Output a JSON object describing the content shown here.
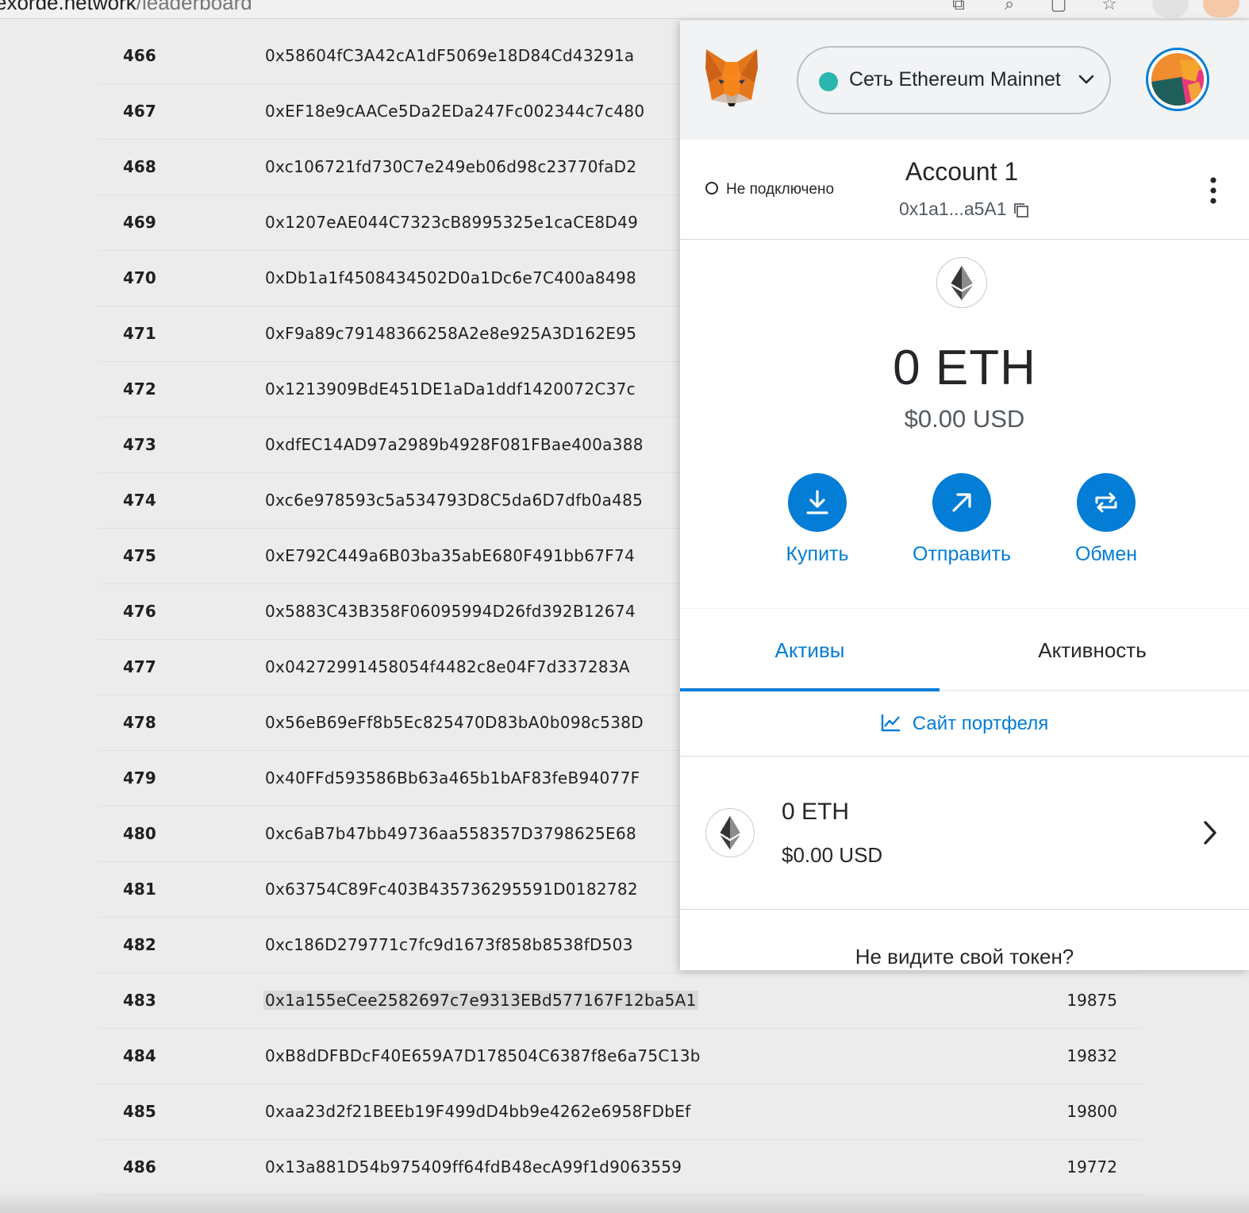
{
  "browser": {
    "url_host": "exorde.network",
    "url_path": "/leaderboard"
  },
  "leaderboard": {
    "rows": [
      {
        "rank": "466",
        "address": "0x58604fC3A42cA1dF5069e18D84Cd43291a",
        "score": ""
      },
      {
        "rank": "467",
        "address": "0xEF18e9cAACe5Da2EDa247Fc002344c7c480",
        "score": ""
      },
      {
        "rank": "468",
        "address": "0xc106721fd730C7e249eb06d98c23770faD2",
        "score": ""
      },
      {
        "rank": "469",
        "address": "0x1207eAE044C7323cB8995325e1caCE8D49",
        "score": ""
      },
      {
        "rank": "470",
        "address": "0xDb1a1f4508434502D0a1Dc6e7C400a8498",
        "score": ""
      },
      {
        "rank": "471",
        "address": "0xF9a89c79148366258A2e8e925A3D162E95",
        "score": ""
      },
      {
        "rank": "472",
        "address": "0x1213909BdE451DE1aDa1ddf1420072C37c",
        "score": ""
      },
      {
        "rank": "473",
        "address": "0xdfEC14AD97a2989b4928F081FBae400a388",
        "score": ""
      },
      {
        "rank": "474",
        "address": "0xc6e978593c5a534793D8C5da6D7dfb0a485",
        "score": ""
      },
      {
        "rank": "475",
        "address": "0xE792C449a6B03ba35abE680F491bb67F74",
        "score": ""
      },
      {
        "rank": "476",
        "address": "0x5883C43B358F06095994D26fd392B12674",
        "score": ""
      },
      {
        "rank": "477",
        "address": "0x04272991458054f4482c8e04F7d337283A",
        "score": ""
      },
      {
        "rank": "478",
        "address": "0x56eB69eFf8b5Ec825470D83bA0b098c538D",
        "score": ""
      },
      {
        "rank": "479",
        "address": "0x40FFd593586Bb63a465b1bAF83feB94077F",
        "score": ""
      },
      {
        "rank": "480",
        "address": "0xc6aB7b47bb49736aa558357D3798625E68",
        "score": ""
      },
      {
        "rank": "481",
        "address": "0x63754C89Fc403B435736295591D0182782",
        "score": ""
      },
      {
        "rank": "482",
        "address": "0xc186D279771c7fc9d1673f858b8538fD503",
        "score": ""
      },
      {
        "rank": "483",
        "address": "0x1a155eCee2582697c7e9313EBd577167F12ba5A1",
        "score": "19875",
        "highlighted": true
      },
      {
        "rank": "484",
        "address": "0xB8dDFBDcF40E659A7D178504C6387f8e6a75C13b",
        "score": "19832"
      },
      {
        "rank": "485",
        "address": "0xaa23d2f21BEEb19F499dD4bb9e4262e6958FDbEf",
        "score": "19800"
      },
      {
        "rank": "486",
        "address": "0x13a881D54b975409ff64fdB48ecA99f1d9063559",
        "score": "19772"
      }
    ]
  },
  "metamask": {
    "network_label": "Сеть Ethereum Mainnet",
    "network_dot_color": "#29b6af",
    "connection_status": "Не подключено",
    "account_name": "Account 1",
    "account_address_short": "0x1a1...a5A1",
    "balance": "0 ETH",
    "balance_usd": "$0.00 USD",
    "actions": [
      {
        "label": "Купить",
        "icon": "download-icon"
      },
      {
        "label": "Отправить",
        "icon": "arrow-up-right-icon"
      },
      {
        "label": "Обмен",
        "icon": "swap-icon"
      }
    ],
    "tabs": [
      {
        "label": "Активы",
        "active": true
      },
      {
        "label": "Активность",
        "active": false
      }
    ],
    "portfolio_link": "Сайт портфеля",
    "asset": {
      "amount": "0 ETH",
      "usd": "$0.00 USD"
    },
    "no_token_prompt": "Не видите свой токен?",
    "accent_color": "#037dd6"
  }
}
